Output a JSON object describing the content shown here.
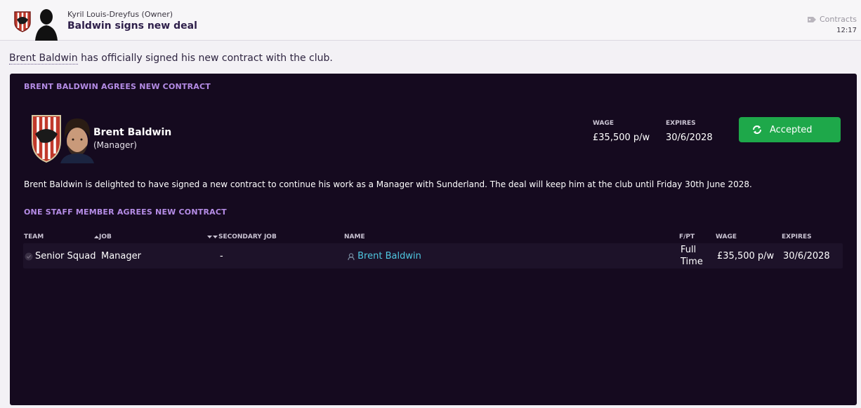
{
  "header": {
    "sender": "Kyril Louis-Dreyfus  (Owner)",
    "subject": "Baldwin signs new deal",
    "category": "Contracts",
    "time": "12:17"
  },
  "intro": {
    "name": "Brent Baldwin",
    "text": " has officially signed his new contract with the club."
  },
  "panel": {
    "title": "BRENT BALDWIN AGREES NEW CONTRACT",
    "person_name": "Brent Baldwin",
    "person_role": "(Manager)",
    "wage_label": "WAGE",
    "wage_value": "£35,500 p/w",
    "expires_label": "EXPIRES",
    "expires_value": "30/6/2028",
    "status_label": "Accepted",
    "description": "Brent Baldwin is delighted to have signed a new contract to continue his work as a Manager with Sunderland. The deal will keep him at the club until Friday 30th June 2028.",
    "section2_title": "ONE STAFF MEMBER AGREES NEW CONTRACT"
  },
  "table": {
    "columns": [
      "TEAM",
      "JOB",
      "SECONDARY JOB",
      "NAME",
      "F/PT",
      "WAGE",
      "EXPIRES"
    ],
    "rows": [
      {
        "team": "Senior Squad",
        "job": "Manager",
        "secondary_job": "-",
        "name": "Brent Baldwin",
        "fpt_1": "Full",
        "fpt_2": "Time",
        "wage": "£35,500 p/w",
        "expires": "30/6/2028"
      }
    ]
  },
  "colors": {
    "panel_bg": "#150a1f",
    "accent_purple": "#b58ce6",
    "accepted_green": "#1ea84a",
    "link_cyan": "#4fc7e0"
  },
  "icons": [
    "club-crest-icon",
    "owner-avatar-icon",
    "tag-icon",
    "manager-face-icon",
    "refresh-icon",
    "check-circle-icon",
    "sort-up-icon",
    "sort-down-icon",
    "person-icon"
  ]
}
